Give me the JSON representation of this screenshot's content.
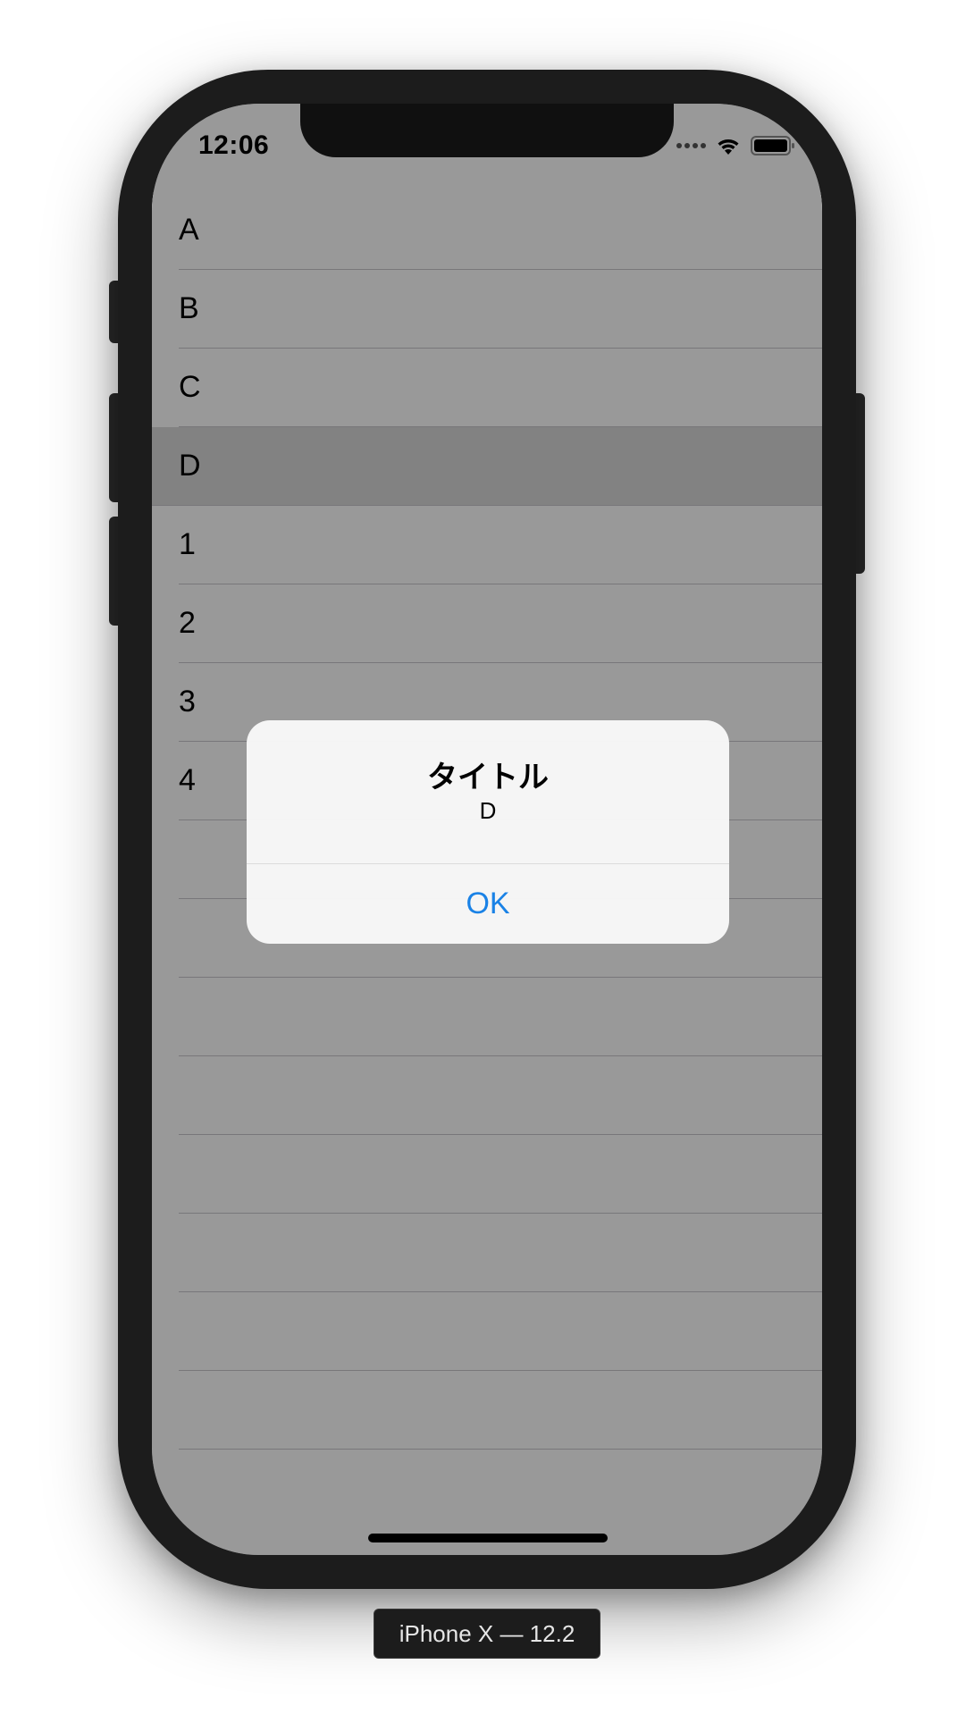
{
  "status_bar": {
    "time": "12:06",
    "icons": [
      "signal-icon",
      "wifi-icon",
      "battery-icon"
    ]
  },
  "list": {
    "items": [
      {
        "label": "A"
      },
      {
        "label": "B"
      },
      {
        "label": "C"
      },
      {
        "label": "D",
        "selected": true
      },
      {
        "label": "1"
      },
      {
        "label": "2"
      },
      {
        "label": "3"
      },
      {
        "label": "4"
      }
    ],
    "empty_rows": 8
  },
  "alert": {
    "title": "タイトル",
    "message": "D",
    "button_label": "OK"
  },
  "simulator": {
    "device_label": "iPhone X — 12.2"
  },
  "colors": {
    "accent": "#1a82e6",
    "device_frame": "#1c1c1c",
    "selected_row": "#d9d9d9"
  }
}
